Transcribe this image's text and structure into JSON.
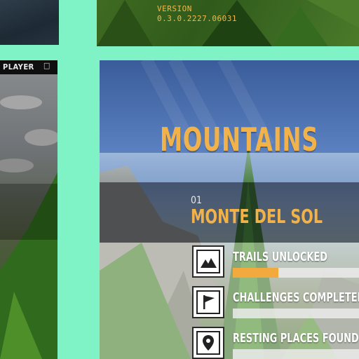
{
  "version": {
    "label": "VERSION",
    "number": "0.3.0.2227.06031"
  },
  "mini_player": {
    "title": "PLAYER",
    "controls": [
      "–",
      "□"
    ]
  },
  "section": {
    "title": "MOUNTAINS"
  },
  "location": {
    "index": "01",
    "name": "MONTE DEL SOL"
  },
  "stats": [
    {
      "label": "TRAILS UNLOCKED",
      "icon": "mountain-icon",
      "progress": 0.34
    },
    {
      "label": "CHALLENGES COMPLETED",
      "icon": "flag-icon",
      "progress": 0.0
    },
    {
      "label": "RESTING PLACES FOUND",
      "icon": "map-pin-icon",
      "progress": 0.0
    }
  ],
  "colors": {
    "accent": "#f2b24a",
    "progress": "#f2a93e",
    "frame": "#7ff2c6"
  }
}
